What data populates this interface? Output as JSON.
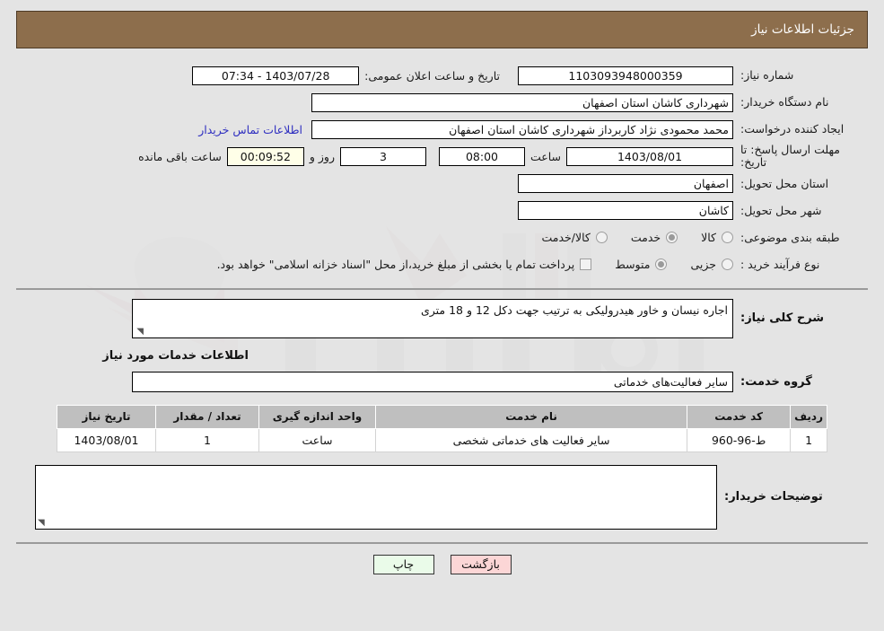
{
  "header": {
    "title": "جزئیات اطلاعات نیاز"
  },
  "top": {
    "need_number_label": "شماره نیاز:",
    "need_number_value": "1103093948000359",
    "public_announce_label": "تاریخ و ساعت اعلان عمومی:",
    "public_announce_value": "1403/07/28 - 07:34",
    "buyer_org_label": "نام دستگاه خریدار:",
    "buyer_org_value": "شهرداری کاشان استان اصفهان",
    "creator_label": "ایجاد کننده درخواست:",
    "creator_value": "محمد محمودی نژاد کاربرداز شهرداری کاشان استان اصفهان",
    "contact_link": "اطلاعات تماس خریدار",
    "deadline_label": "مهلت ارسال پاسخ: تا تاریخ:",
    "deadline_date": "1403/08/01",
    "hour_label": "ساعت",
    "hour_value": "08:00",
    "days_value": "3",
    "days_word": "روز و",
    "countdown_value": "00:09:52",
    "remaining_word": "ساعت باقی مانده",
    "province_label": "استان محل تحویل:",
    "province_value": "اصفهان",
    "city_label": "شهر محل تحویل:",
    "city_value": "کاشان",
    "category_label": "طبقه بندی موضوعی:",
    "category_options": [
      {
        "label": "کالا",
        "selected": false
      },
      {
        "label": "خدمت",
        "selected": true
      },
      {
        "label": "کالا/خدمت",
        "selected": false
      }
    ],
    "process_label": "نوع فرآیند خرید :",
    "process_options": [
      {
        "label": "جزیی",
        "selected": false
      },
      {
        "label": "متوسط",
        "selected": true
      }
    ],
    "treasury_checkbox_checked": false,
    "treasury_note": "پرداخت تمام یا بخشی از مبلغ خرید،از محل \"اسناد خزانه اسلامی\" خواهد بود."
  },
  "middle": {
    "general_desc_label": "شرح کلی نیاز:",
    "general_desc_value": "اجاره نیسان و خاور هیدرولیکی به ترتیب جهت دکل 12 و 18 متری",
    "services_section_title": "اطلاعات خدمات مورد نیاز",
    "service_group_label": "گروه خدمت:",
    "service_group_value": "سایر فعالیت‌های خدماتی"
  },
  "table": {
    "headers": [
      "ردیف",
      "کد خدمت",
      "نام خدمت",
      "واحد اندازه گیری",
      "تعداد / مقدار",
      "تاریخ نیاز"
    ],
    "rows": [
      {
        "row_no": "1",
        "service_code": "ط-96-960",
        "service_name": "سایر فعالیت های خدماتی شخصی",
        "unit": "ساعت",
        "quantity": "1",
        "need_date": "1403/08/01"
      }
    ]
  },
  "notes": {
    "label": "توضیحات خریدار:",
    "value": ""
  },
  "footer": {
    "print_label": "چاپ",
    "back_label": "بازگشت"
  },
  "watermark": {
    "text": "AriaTender.net"
  },
  "colors": {
    "header_bg": "#8d6e4c",
    "print_btn": "#eafbe9",
    "back_btn": "#fcd6d6",
    "countdown_bg": "#ffffe8",
    "link": "#2f2fc0"
  }
}
